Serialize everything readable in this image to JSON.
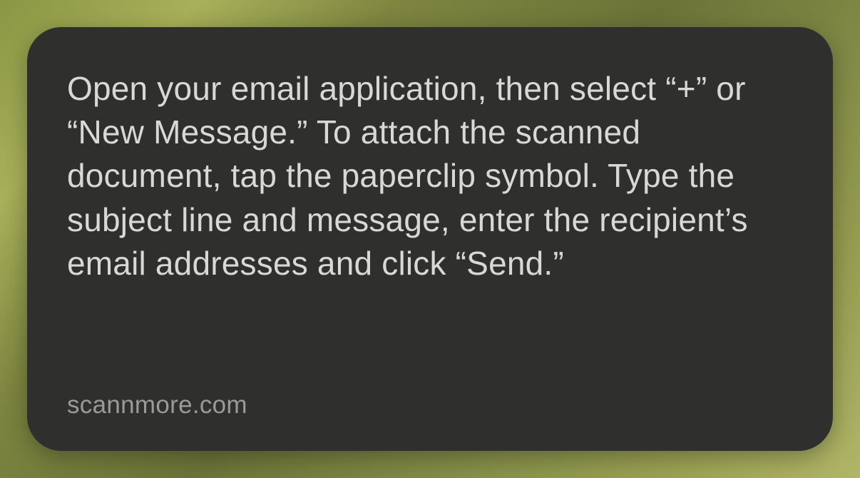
{
  "card": {
    "body": "Open your email application, then select “+” or “New Message.” To attach the scanned document, tap the paperclip symbol. Type the subject line and message, enter the recipient’s email addresses and click “Send.”",
    "source": "scannmore.com"
  }
}
